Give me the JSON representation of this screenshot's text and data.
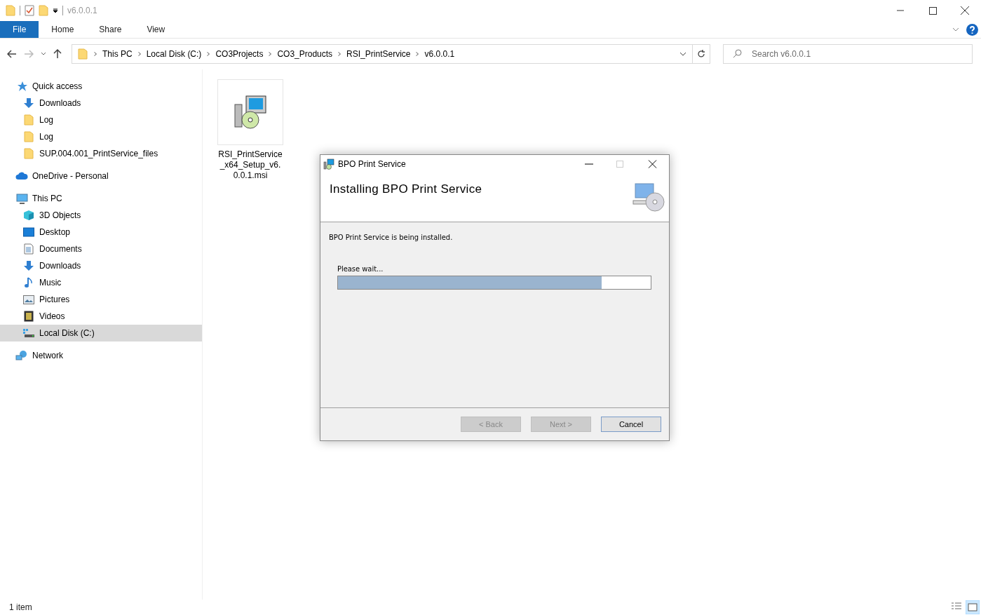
{
  "window": {
    "title": "v6.0.0.1"
  },
  "ribbon_tabs": [
    {
      "label": "File",
      "kind": "file"
    },
    {
      "label": "Home",
      "kind": "tab"
    },
    {
      "label": "Share",
      "kind": "tab"
    },
    {
      "label": "View",
      "kind": "tab"
    }
  ],
  "breadcrumb": [
    "This PC",
    "Local Disk (C:)",
    "CO3Projects",
    "CO3_Products",
    "RSI_PrintService",
    "v6.0.0.1"
  ],
  "search": {
    "placeholder": "Search v6.0.0.1"
  },
  "sidebar": {
    "items": [
      {
        "label": "Quick access",
        "kind": "star",
        "selected": false,
        "children": [
          {
            "label": "Downloads",
            "kind": "download",
            "selected": false
          },
          {
            "label": "Log",
            "kind": "folder",
            "selected": false
          },
          {
            "label": "Log",
            "kind": "folder",
            "selected": false
          },
          {
            "label": "SUP.004.001_PrintService_files",
            "kind": "folder",
            "selected": false
          }
        ]
      },
      {
        "label": "OneDrive - Personal",
        "kind": "cloud",
        "selected": false
      },
      {
        "label": "This PC",
        "kind": "pc",
        "selected": false,
        "children": [
          {
            "label": "3D Objects",
            "kind": "cube",
            "selected": false
          },
          {
            "label": "Desktop",
            "kind": "desktop",
            "selected": false
          },
          {
            "label": "Documents",
            "kind": "document",
            "selected": false
          },
          {
            "label": "Downloads",
            "kind": "download",
            "selected": false
          },
          {
            "label": "Music",
            "kind": "music",
            "selected": false
          },
          {
            "label": "Pictures",
            "kind": "picture",
            "selected": false
          },
          {
            "label": "Videos",
            "kind": "video",
            "selected": false
          },
          {
            "label": "Local Disk (C:)",
            "kind": "disk",
            "selected": true
          }
        ]
      },
      {
        "label": "Network",
        "kind": "network",
        "selected": false
      }
    ]
  },
  "files": [
    {
      "name": "RSI_PrintService_x64_Setup_v6.0.0.1.msi"
    }
  ],
  "status_bar": {
    "item_count": "1 item"
  },
  "dialog": {
    "title": "BPO Print Service",
    "heading": "Installing BPO Print Service",
    "message": "BPO Print Service is being installed.",
    "progress_label": "Please wait...",
    "level": 0.844,
    "buttons": [
      {
        "label": "< Back",
        "disabled": true
      },
      {
        "label": "Next >",
        "disabled": true
      },
      {
        "label": "Cancel",
        "disabled": false
      }
    ]
  }
}
